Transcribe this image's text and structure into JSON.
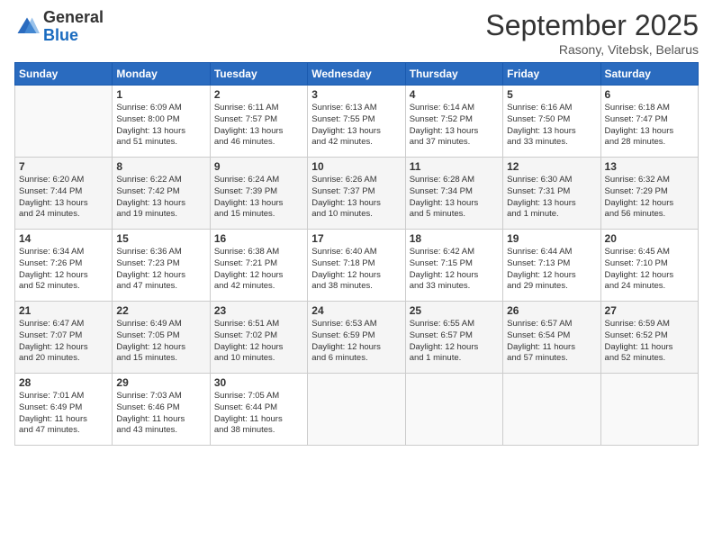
{
  "header": {
    "logo": {
      "general": "General",
      "blue": "Blue"
    },
    "title": "September 2025",
    "location": "Rasony, Vitebsk, Belarus"
  },
  "calendar": {
    "headers": [
      "Sunday",
      "Monday",
      "Tuesday",
      "Wednesday",
      "Thursday",
      "Friday",
      "Saturday"
    ],
    "rows": [
      [
        {
          "day": "",
          "info": ""
        },
        {
          "day": "1",
          "info": "Sunrise: 6:09 AM\nSunset: 8:00 PM\nDaylight: 13 hours\nand 51 minutes."
        },
        {
          "day": "2",
          "info": "Sunrise: 6:11 AM\nSunset: 7:57 PM\nDaylight: 13 hours\nand 46 minutes."
        },
        {
          "day": "3",
          "info": "Sunrise: 6:13 AM\nSunset: 7:55 PM\nDaylight: 13 hours\nand 42 minutes."
        },
        {
          "day": "4",
          "info": "Sunrise: 6:14 AM\nSunset: 7:52 PM\nDaylight: 13 hours\nand 37 minutes."
        },
        {
          "day": "5",
          "info": "Sunrise: 6:16 AM\nSunset: 7:50 PM\nDaylight: 13 hours\nand 33 minutes."
        },
        {
          "day": "6",
          "info": "Sunrise: 6:18 AM\nSunset: 7:47 PM\nDaylight: 13 hours\nand 28 minutes."
        }
      ],
      [
        {
          "day": "7",
          "info": "Sunrise: 6:20 AM\nSunset: 7:44 PM\nDaylight: 13 hours\nand 24 minutes."
        },
        {
          "day": "8",
          "info": "Sunrise: 6:22 AM\nSunset: 7:42 PM\nDaylight: 13 hours\nand 19 minutes."
        },
        {
          "day": "9",
          "info": "Sunrise: 6:24 AM\nSunset: 7:39 PM\nDaylight: 13 hours\nand 15 minutes."
        },
        {
          "day": "10",
          "info": "Sunrise: 6:26 AM\nSunset: 7:37 PM\nDaylight: 13 hours\nand 10 minutes."
        },
        {
          "day": "11",
          "info": "Sunrise: 6:28 AM\nSunset: 7:34 PM\nDaylight: 13 hours\nand 5 minutes."
        },
        {
          "day": "12",
          "info": "Sunrise: 6:30 AM\nSunset: 7:31 PM\nDaylight: 13 hours\nand 1 minute."
        },
        {
          "day": "13",
          "info": "Sunrise: 6:32 AM\nSunset: 7:29 PM\nDaylight: 12 hours\nand 56 minutes."
        }
      ],
      [
        {
          "day": "14",
          "info": "Sunrise: 6:34 AM\nSunset: 7:26 PM\nDaylight: 12 hours\nand 52 minutes."
        },
        {
          "day": "15",
          "info": "Sunrise: 6:36 AM\nSunset: 7:23 PM\nDaylight: 12 hours\nand 47 minutes."
        },
        {
          "day": "16",
          "info": "Sunrise: 6:38 AM\nSunset: 7:21 PM\nDaylight: 12 hours\nand 42 minutes."
        },
        {
          "day": "17",
          "info": "Sunrise: 6:40 AM\nSunset: 7:18 PM\nDaylight: 12 hours\nand 38 minutes."
        },
        {
          "day": "18",
          "info": "Sunrise: 6:42 AM\nSunset: 7:15 PM\nDaylight: 12 hours\nand 33 minutes."
        },
        {
          "day": "19",
          "info": "Sunrise: 6:44 AM\nSunset: 7:13 PM\nDaylight: 12 hours\nand 29 minutes."
        },
        {
          "day": "20",
          "info": "Sunrise: 6:45 AM\nSunset: 7:10 PM\nDaylight: 12 hours\nand 24 minutes."
        }
      ],
      [
        {
          "day": "21",
          "info": "Sunrise: 6:47 AM\nSunset: 7:07 PM\nDaylight: 12 hours\nand 20 minutes."
        },
        {
          "day": "22",
          "info": "Sunrise: 6:49 AM\nSunset: 7:05 PM\nDaylight: 12 hours\nand 15 minutes."
        },
        {
          "day": "23",
          "info": "Sunrise: 6:51 AM\nSunset: 7:02 PM\nDaylight: 12 hours\nand 10 minutes."
        },
        {
          "day": "24",
          "info": "Sunrise: 6:53 AM\nSunset: 6:59 PM\nDaylight: 12 hours\nand 6 minutes."
        },
        {
          "day": "25",
          "info": "Sunrise: 6:55 AM\nSunset: 6:57 PM\nDaylight: 12 hours\nand 1 minute."
        },
        {
          "day": "26",
          "info": "Sunrise: 6:57 AM\nSunset: 6:54 PM\nDaylight: 11 hours\nand 57 minutes."
        },
        {
          "day": "27",
          "info": "Sunrise: 6:59 AM\nSunset: 6:52 PM\nDaylight: 11 hours\nand 52 minutes."
        }
      ],
      [
        {
          "day": "28",
          "info": "Sunrise: 7:01 AM\nSunset: 6:49 PM\nDaylight: 11 hours\nand 47 minutes."
        },
        {
          "day": "29",
          "info": "Sunrise: 7:03 AM\nSunset: 6:46 PM\nDaylight: 11 hours\nand 43 minutes."
        },
        {
          "day": "30",
          "info": "Sunrise: 7:05 AM\nSunset: 6:44 PM\nDaylight: 11 hours\nand 38 minutes."
        },
        {
          "day": "",
          "info": ""
        },
        {
          "day": "",
          "info": ""
        },
        {
          "day": "",
          "info": ""
        },
        {
          "day": "",
          "info": ""
        }
      ]
    ]
  }
}
